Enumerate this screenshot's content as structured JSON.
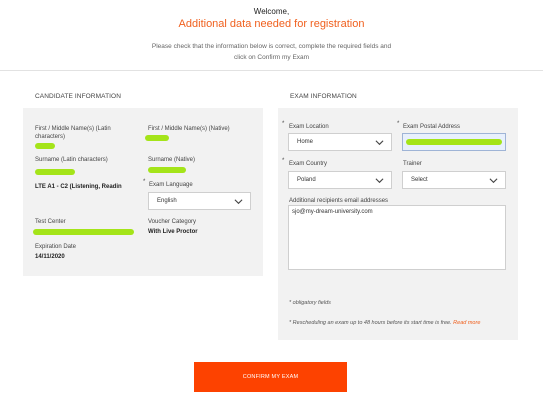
{
  "header": {
    "welcome": "Welcome,",
    "title": "Additional data needed for registration",
    "intro": "Please check that the information below is correct, complete the required fields and click on Confirm my Exam"
  },
  "candidate": {
    "section_title": "CANDIDATE INFORMATION",
    "first_name_latin_label": "First / Middle Name(s) (Latin characters)",
    "first_name_native_label": "First / Middle Name(s) (Native)",
    "surname_latin_label": "Surname (Latin characters)",
    "surname_native_label": "Surname (Native)",
    "exam_name": "LTE A1 - C2 (Listening, Readin",
    "exam_language_label": "Exam Language",
    "exam_language_value": "English",
    "test_center_label": "Test Center",
    "voucher_label": "Voucher Category",
    "voucher_value": "With Live Proctor",
    "expiration_label": "Expiration Date",
    "expiration_value": "14/11/2020"
  },
  "exam": {
    "section_title": "EXAM INFORMATION",
    "location_label": "Exam Location",
    "location_value": "Home",
    "postal_label": "Exam Postal Address",
    "country_label": "Exam Country",
    "country_value": "Poland",
    "trainer_label": "Trainer",
    "trainer_value": "Select",
    "recipients_label": "Additional recipients email addresses",
    "recipients_value": "sjo@my-dream-university.com",
    "obligatory_note": "* obligatory fields",
    "reschedule_note": "* Rescheduling an exam up to 48 hours before its start time is free.",
    "read_more": "Read more"
  },
  "actions": {
    "confirm_label": "CONFIRM MY EXAM"
  },
  "colors": {
    "accent": "#fd4200",
    "highlight": "#a4e419",
    "panel": "#f2f2f2"
  }
}
